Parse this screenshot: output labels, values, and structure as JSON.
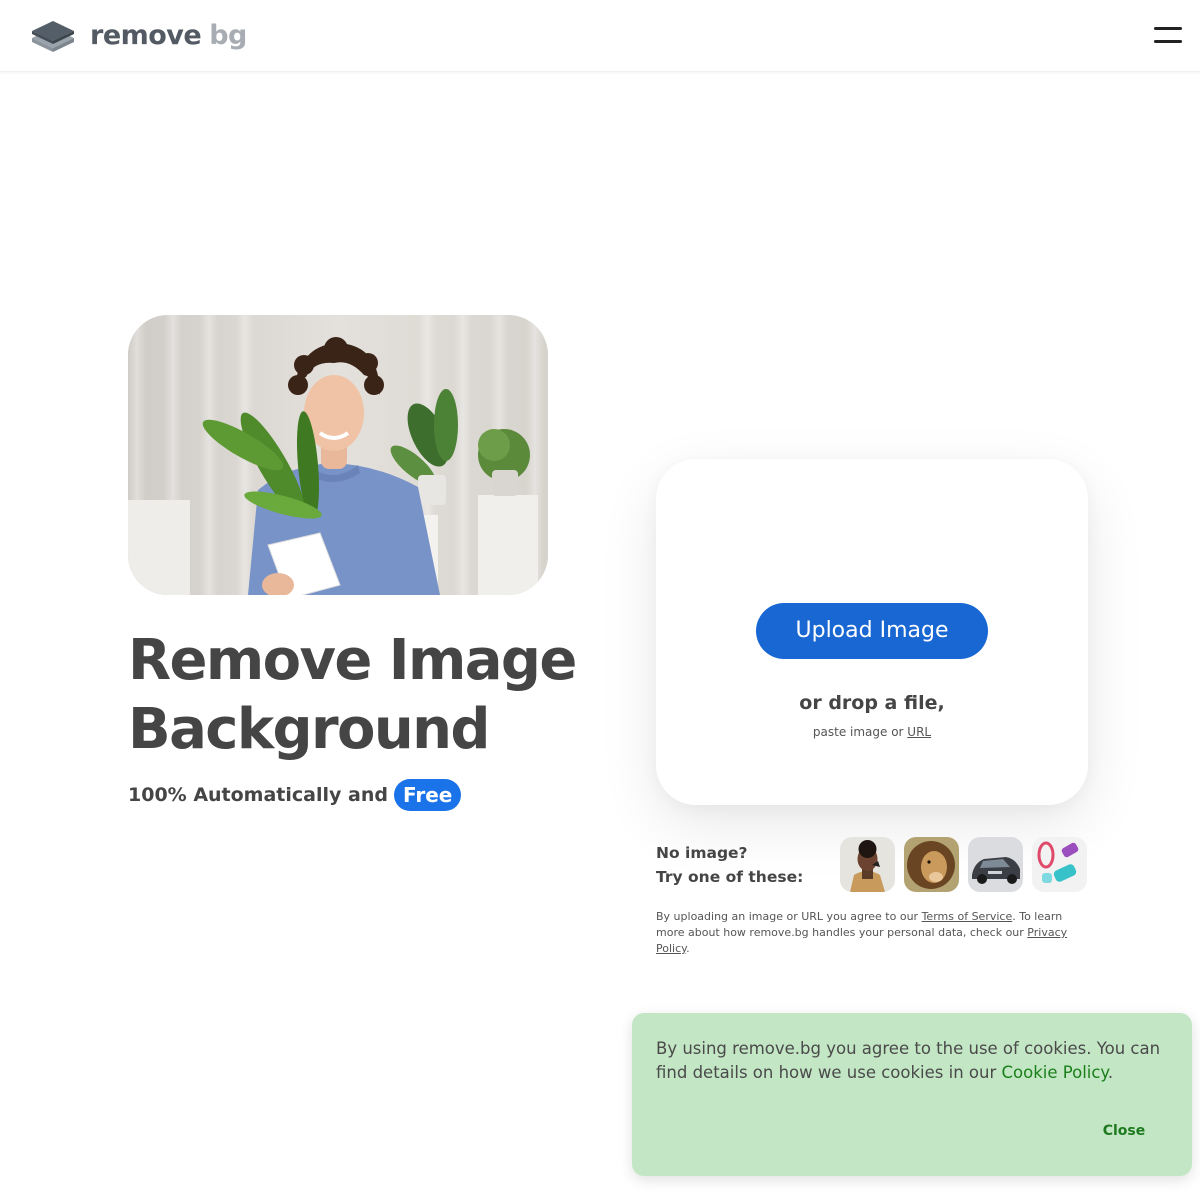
{
  "header": {
    "logo": {
      "word1": "remove",
      "word2": "bg",
      "icon": "layers-logo-icon"
    },
    "menu_icon": "hamburger-menu-icon"
  },
  "hero": {
    "title_line1": "Remove Image",
    "title_line2": "Background",
    "subtitle": "100% Automatically and",
    "free_badge": "Free"
  },
  "upload": {
    "button_label": "Upload Image",
    "drop_text": "or drop a file,",
    "paste_prefix": "paste image or ",
    "url_link": "URL"
  },
  "samples": {
    "label_line1": "No image?",
    "label_line2": "Try one of these:",
    "items": [
      "woman-thumbnail",
      "lion-thumbnail",
      "car-thumbnail",
      "fitness-gear-thumbnail"
    ]
  },
  "legal": {
    "part1": "By uploading an image or URL you agree to our ",
    "tos_link": "Terms of Service",
    "part2": ". To learn more about how remove.bg handles your personal data, check our ",
    "privacy_link": "Privacy Policy",
    "part3": "."
  },
  "cookie": {
    "text": "By using remove.bg you agree to the use of cookies. You can find details on how we use cookies in our ",
    "policy_link": "Cookie Policy",
    "period": ".",
    "close_label": "Close"
  },
  "colors": {
    "accent_blue": "#1967d2",
    "text_dark": "#454545",
    "cookie_bg": "#c3e6c5",
    "cookie_link": "#1a7f1a"
  }
}
